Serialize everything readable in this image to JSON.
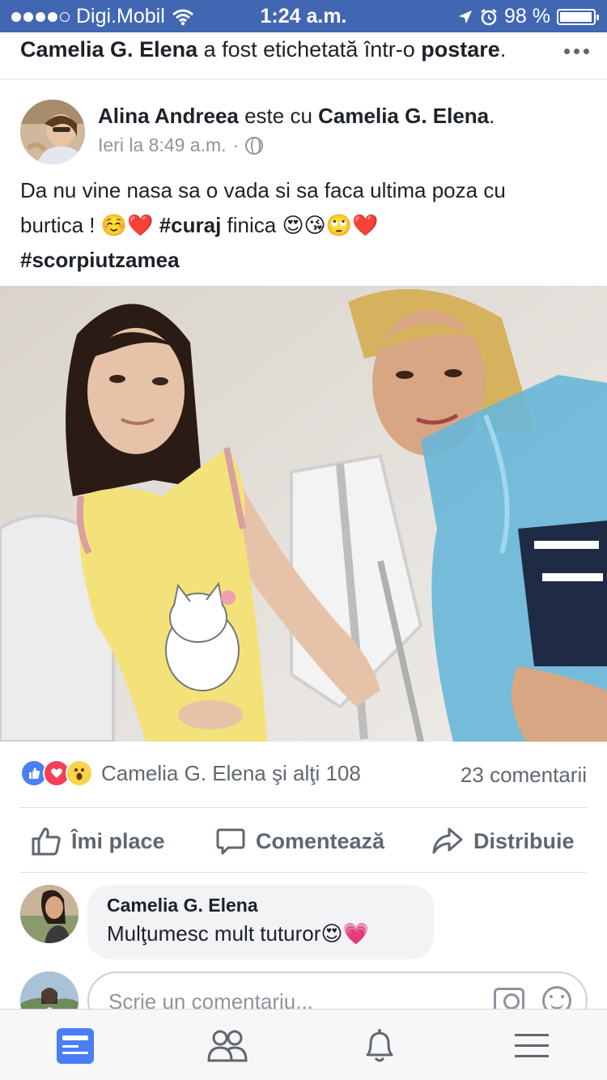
{
  "status_bar": {
    "carrier": "Digi.Mobil",
    "time": "1:24 a.m.",
    "battery": "98 %",
    "battery_level": 0.98,
    "signal_bars": 4
  },
  "notification": {
    "name": "Camelia G. Elena",
    "middle": " a fost etichetată într-o ",
    "target": "postare",
    "end": "."
  },
  "post": {
    "author": "Alina Andreea",
    "connector": " este cu ",
    "tagged": "Camelia G. Elena",
    "end": ".",
    "timestamp": "Ieri la 8:49 a.m.",
    "separator": "·",
    "line1": "Da nu vine nasa sa o vada si sa faca ultima poza cu",
    "line2_start": "burtica ! ☺️❤️ ",
    "hashtag1": "#curaj",
    "line2_end": " finica 😍😘🙄❤️",
    "hashtag2": "#scorpiutzamea"
  },
  "reactions": {
    "summary": "Camelia G. Elena şi alţi 108",
    "comments": "23 comentarii",
    "icons": [
      "like-icon",
      "love-icon",
      "wow-icon"
    ],
    "colors": {
      "like": "#4a7ef6",
      "love": "#f33e58",
      "wow": "#fcd34a"
    }
  },
  "actions": {
    "like": "Îmi place",
    "comment": "Comentează",
    "share": "Distribuie"
  },
  "comment": {
    "author": "Camelia G. Elena",
    "text": "Mulţumesc mult tuturor😍💗"
  },
  "composer": {
    "placeholder": "Scrie un comentariu..."
  },
  "tabbar": {
    "items": [
      "news-feed-icon",
      "friends-icon",
      "notifications-icon",
      "menu-icon"
    ],
    "active_color": "#4267b2"
  }
}
